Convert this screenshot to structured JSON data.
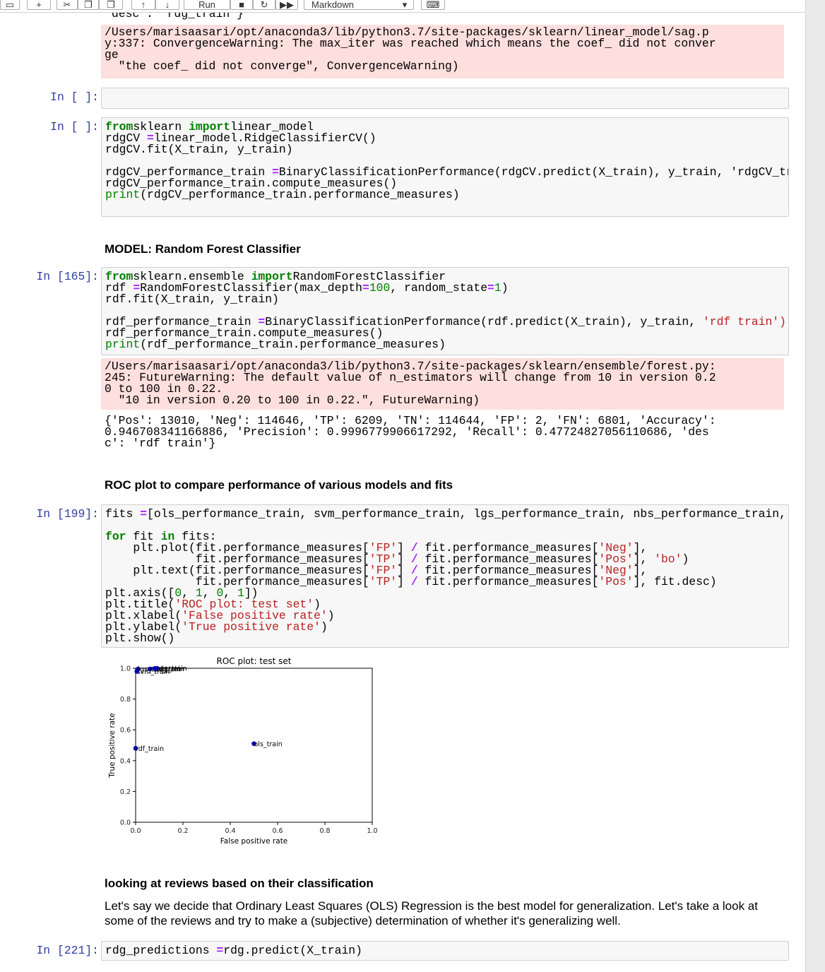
{
  "toolbar": {
    "run_label": "Run",
    "cell_type": "Markdown"
  },
  "cells": {
    "prev_output_line": "desc': 'rdg_train'}",
    "sag_warning": [
      "/Users/marisaasari/opt/anaconda3/lib/python3.7/site-packages/sklearn/linear_model/sag.p",
      "y:337: ConvergenceWarning: The max_iter was reached which means the coef_ did not conver",
      "ge",
      "  \"the coef_ did not converge\", ConvergenceWarning)"
    ],
    "empty_prompt": "In [ ]:",
    "ridgecv_prompt": "In [ ]:",
    "rf_heading": "MODEL: Random Forest Classifier",
    "rf_prompt": "In [165]:",
    "rf_warning": [
      "/Users/marisaasari/opt/anaconda3/lib/python3.7/site-packages/sklearn/ensemble/forest.py:",
      "245: FutureWarning: The default value of n_estimators will change from 10 in version 0.2",
      "0 to 100 in 0.22.",
      "  \"10 in version 0.20 to 100 in 0.22.\", FutureWarning)"
    ],
    "rf_output": [
      "{'Pos': 13010, 'Neg': 114646, 'TP': 6209, 'TN': 114644, 'FP': 2, 'FN': 6801, 'Accuracy':",
      "0.946708341166886, 'Precision': 0.9996779906617292, 'Recall': 0.47724827056110686, 'des",
      "c': 'rdf train'}"
    ],
    "roc_heading": "ROC plot to compare performance of various models and fits",
    "roc_prompt": "In [199]:",
    "reviews_heading": "looking at reviews based on their classification",
    "reviews_text": "Let's say we decide that Ordinary Least Squares (OLS) Regression is the best model for generalization. Let's take a look at some of the reviews and try to make a (subjective) determination of whether it's generalizing well.",
    "pred_prompt": "In [221]:"
  },
  "code": {
    "ridgecv": [
      [
        [
          "kw",
          "from"
        ],
        [
          "",
          "sklearn "
        ],
        [
          "kw",
          "import"
        ],
        [
          "",
          "linear_model"
        ]
      ],
      [
        [
          "",
          "rdgCV "
        ],
        [
          "op",
          "="
        ],
        [
          "",
          "linear_model.RidgeClassifierCV()"
        ]
      ],
      [
        [
          "",
          "rdgCV.fit(X_train, y_train)"
        ]
      ],
      [],
      [
        [
          "",
          "rdgCV_performance_train "
        ],
        [
          "op",
          "="
        ],
        [
          "",
          "BinaryClassificationPerformance(rdgCV.predict(X_train), y_train, 'rdgCV_train')"
        ]
      ],
      [
        [
          "",
          "rdgCV_performance_train.compute_measures()"
        ]
      ],
      [
        [
          "bi",
          "print"
        ],
        [
          "",
          "(rdgCV_performance_train.performance_measures)"
        ]
      ]
    ],
    "rf": [
      [
        [
          "kw",
          "from"
        ],
        [
          "",
          "sklearn.ensemble "
        ],
        [
          "kw",
          "import"
        ],
        [
          "",
          "RandomForestClassifier"
        ]
      ],
      [
        [
          "",
          "rdf "
        ],
        [
          "op",
          "="
        ],
        [
          "",
          "RandomForestClassifier(max_depth"
        ],
        [
          "op",
          "="
        ],
        [
          "nm",
          "100"
        ],
        [
          "",
          ", random_state"
        ],
        [
          "op",
          "="
        ],
        [
          "nm",
          "1"
        ],
        [
          "",
          ")"
        ]
      ],
      [
        [
          "",
          "rdf.fit(X_train, y_train)"
        ]
      ],
      [],
      [
        [
          "",
          "rdf_performance_train "
        ],
        [
          "op",
          "="
        ],
        [
          "",
          "BinaryClassificationPerformance(rdf.predict(X_train), y_train, "
        ],
        [
          "st",
          "'rdf train')"
        ]
      ],
      [
        [
          "",
          "rdf_performance_train.compute_measures()"
        ]
      ],
      [
        [
          "bi",
          "print"
        ],
        [
          "",
          "(rdf_performance_train.performance_measures)"
        ]
      ]
    ],
    "roc": [
      [
        [
          "",
          "fits "
        ],
        [
          "op",
          "="
        ],
        [
          "",
          "[ols_performance_train, svm_performance_train, lgs_performance_train, nbs_performance_train, prc_performance_train, rdg_performance_train, rdf_performance_train]"
        ]
      ],
      [],
      [
        [
          "kw",
          "for"
        ],
        [
          "",
          ""
        ],
        [
          "",
          "fit "
        ],
        [
          "kw",
          "in"
        ],
        [
          "",
          ""
        ],
        [
          "",
          "fits:"
        ]
      ],
      [
        [
          "",
          "    plt.plot(fit.performance_measures["
        ],
        [
          "st",
          "'FP'"
        ],
        [
          "",
          "] "
        ],
        [
          "op",
          "/"
        ],
        [
          "",
          ""
        ],
        [
          "",
          "fit.performance_measures["
        ],
        [
          "st",
          "'Neg'"
        ],
        [
          "",
          "],"
        ]
      ],
      [
        [
          "",
          "             fit.performance_measures["
        ],
        [
          "st",
          "'TP'"
        ],
        [
          "",
          "] "
        ],
        [
          "op",
          "/"
        ],
        [
          "",
          ""
        ],
        [
          "",
          "fit.performance_measures["
        ],
        [
          "st",
          "'Pos'"
        ],
        [
          "",
          "], "
        ],
        [
          "st",
          "'bo'"
        ],
        [
          "",
          ")"
        ]
      ],
      [
        [
          "",
          "    plt.text(fit.performance_measures["
        ],
        [
          "st",
          "'FP'"
        ],
        [
          "",
          "] "
        ],
        [
          "op",
          "/"
        ],
        [
          "",
          ""
        ],
        [
          "",
          "fit.performance_measures["
        ],
        [
          "st",
          "'Neg'"
        ],
        [
          "",
          "],"
        ]
      ],
      [
        [
          "",
          "             fit.performance_measures["
        ],
        [
          "st",
          "'TP'"
        ],
        [
          "",
          "] "
        ],
        [
          "op",
          "/"
        ],
        [
          "",
          ""
        ],
        [
          "",
          "fit.performance_measures["
        ],
        [
          "st",
          "'Pos'"
        ],
        [
          "",
          "], fit.desc)"
        ]
      ],
      [
        [
          "",
          "plt.axis(["
        ],
        [
          "nm",
          "0"
        ],
        [
          "",
          ", "
        ],
        [
          "nm",
          "1"
        ],
        [
          "",
          ", "
        ],
        [
          "nm",
          "0"
        ],
        [
          "",
          ", "
        ],
        [
          "nm",
          "1"
        ],
        [
          "",
          "])"
        ]
      ],
      [
        [
          "",
          "plt.title("
        ],
        [
          "st",
          "'ROC plot: test set'"
        ],
        [
          "",
          ")"
        ]
      ],
      [
        [
          "",
          "plt.xlabel("
        ],
        [
          "st",
          "'False positive rate'"
        ],
        [
          "",
          ")"
        ]
      ],
      [
        [
          "",
          "plt.ylabel("
        ],
        [
          "st",
          "'True positive rate'"
        ],
        [
          "",
          ")"
        ]
      ],
      [
        [
          "",
          "plt.show()"
        ]
      ]
    ],
    "pred": [
      [
        [
          "",
          "rdg_predictions "
        ],
        [
          "op",
          "="
        ],
        [
          "",
          "rdg.predict(X_train)"
        ]
      ]
    ]
  },
  "chart_data": {
    "type": "scatter",
    "title": "ROC plot: test set",
    "xlabel": "False positive rate",
    "ylabel": "True positive rate",
    "xlim": [
      0,
      1
    ],
    "ylim": [
      0,
      1
    ],
    "xticks": [
      "0.0",
      "0.2",
      "0.4",
      "0.6",
      "0.8",
      "1.0"
    ],
    "yticks": [
      "0.0",
      "0.2",
      "0.4",
      "0.6",
      "0.8",
      "1.0"
    ],
    "grid": false,
    "point_color": "#0000bf",
    "points": [
      {
        "label": "ols_train",
        "x": 0.5,
        "y": 0.51
      },
      {
        "label": "svm_train",
        "x": 0.005,
        "y": 0.98
      },
      {
        "label": "lgs_train",
        "x": 0.01,
        "y": 0.995
      },
      {
        "label": "nbs_train",
        "x": 0.06,
        "y": 0.995
      },
      {
        "label": "prc_train",
        "x": 0.08,
        "y": 0.998
      },
      {
        "label": "rdg_train",
        "x": 0.09,
        "y": 1.0
      },
      {
        "label": "rdf_train",
        "x": 0.0,
        "y": 0.48
      }
    ]
  }
}
